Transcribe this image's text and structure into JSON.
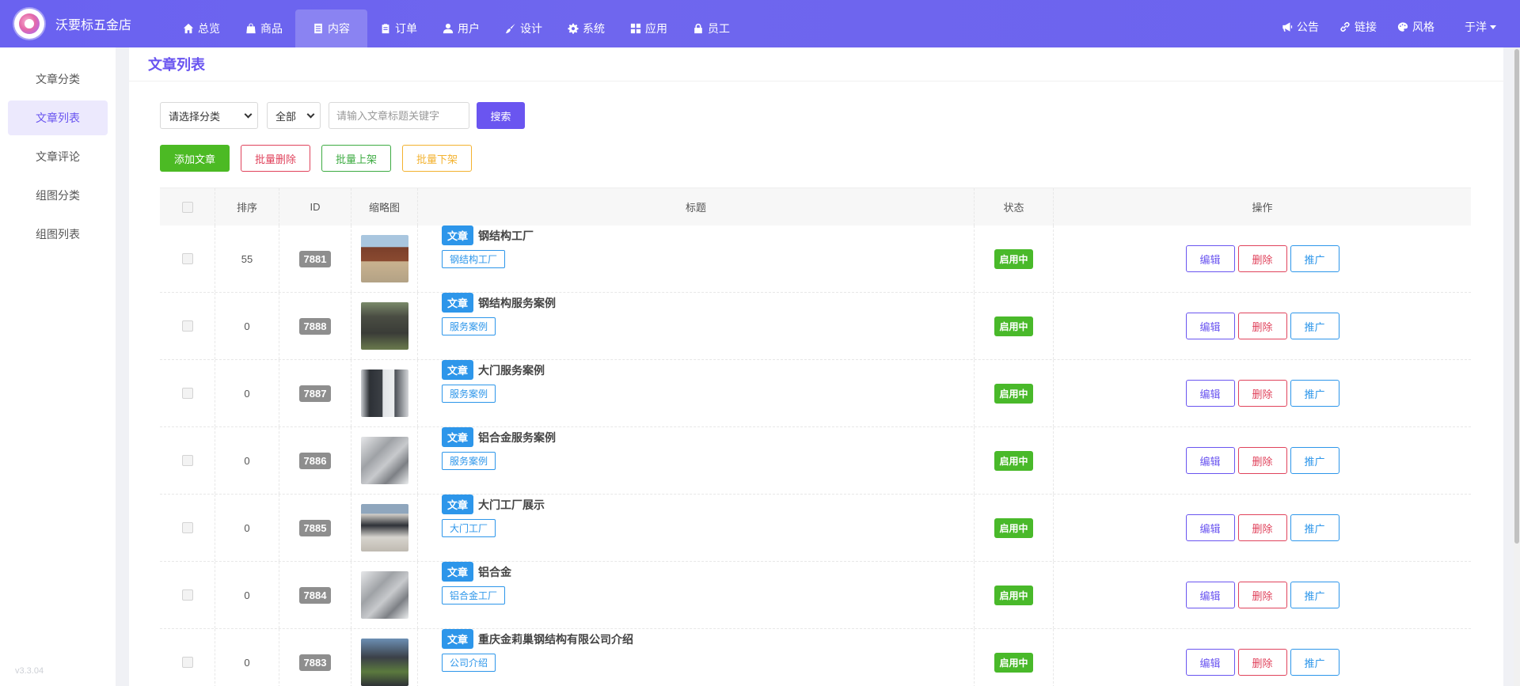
{
  "app": {
    "name": "沃要标五金店",
    "version": "v3.3.04"
  },
  "nav": {
    "items": [
      {
        "label": "总览",
        "icon": "home-icon",
        "active": false
      },
      {
        "label": "商品",
        "icon": "bag-icon",
        "active": false
      },
      {
        "label": "内容",
        "icon": "document-icon",
        "active": true
      },
      {
        "label": "订单",
        "icon": "clipboard-icon",
        "active": false
      },
      {
        "label": "用户",
        "icon": "user-icon",
        "active": false
      },
      {
        "label": "设计",
        "icon": "brush-icon",
        "active": false
      },
      {
        "label": "系统",
        "icon": "gear-icon",
        "active": false
      },
      {
        "label": "应用",
        "icon": "grid-icon",
        "active": false
      },
      {
        "label": "员工",
        "icon": "lock-icon",
        "active": false
      }
    ]
  },
  "tools": {
    "announce": "公告",
    "link": "链接",
    "style": "风格",
    "user": "于洋"
  },
  "sidebar": {
    "items": [
      {
        "label": "文章分类",
        "active": false
      },
      {
        "label": "文章列表",
        "active": true
      },
      {
        "label": "文章评论",
        "active": false
      },
      {
        "label": "组图分类",
        "active": false
      },
      {
        "label": "组图列表",
        "active": false
      }
    ]
  },
  "page": {
    "title": "文章列表"
  },
  "filters": {
    "category_select": "请选择分类",
    "status_select": "全部",
    "search_placeholder": "请输入文章标题关键字",
    "search_button": "搜索"
  },
  "actions": {
    "add": "添加文章",
    "batch_delete": "批量删除",
    "batch_publish": "批量上架",
    "batch_unpublish": "批量下架"
  },
  "table": {
    "headers": {
      "sort": "排序",
      "id": "ID",
      "thumb": "缩略图",
      "title": "标题",
      "status": "状态",
      "ops": "操作"
    },
    "op_labels": {
      "edit": "编辑",
      "delete": "删除",
      "promote": "推广"
    },
    "rows": [
      {
        "sort": "55",
        "id": "7881",
        "type": "文章",
        "title": "钢结构工厂",
        "category": "钢结构工厂",
        "status": "启用中"
      },
      {
        "sort": "0",
        "id": "7888",
        "type": "文章",
        "title": "钢结构服务案例",
        "category": "服务案例",
        "status": "启用中"
      },
      {
        "sort": "0",
        "id": "7887",
        "type": "文章",
        "title": "大门服务案例",
        "category": "服务案例",
        "status": "启用中"
      },
      {
        "sort": "0",
        "id": "7886",
        "type": "文章",
        "title": "铝合金服务案例",
        "category": "服务案例",
        "status": "启用中"
      },
      {
        "sort": "0",
        "id": "7885",
        "type": "文章",
        "title": "大门工厂展示",
        "category": "大门工厂",
        "status": "启用中"
      },
      {
        "sort": "0",
        "id": "7884",
        "type": "文章",
        "title": "铝合金",
        "category": "铝合金工厂",
        "status": "启用中"
      },
      {
        "sort": "0",
        "id": "7883",
        "type": "文章",
        "title": "重庆金莉巢钢结构有限公司介绍",
        "category": "公司介绍",
        "status": "启用中"
      }
    ]
  }
}
